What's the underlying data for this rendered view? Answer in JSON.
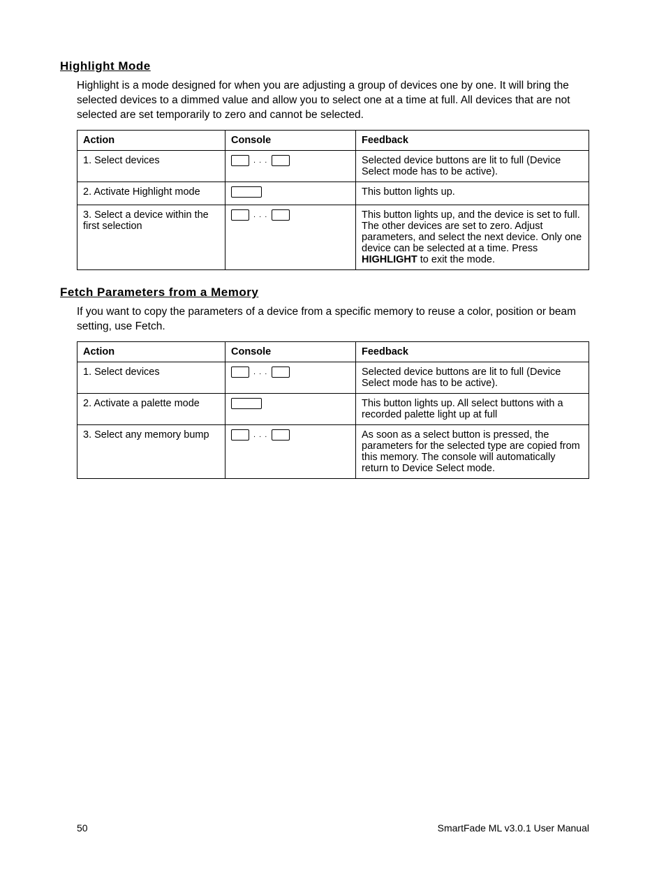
{
  "section1": {
    "heading": "Highlight Mode",
    "paragraph": "Highlight is a mode designed for when you are adjusting a group of devices one by one. It will bring the selected devices to a dimmed value and allow you to select one at a time at full. All devices that are not selected are set temporarily to zero and cannot be selected.",
    "headers": {
      "action": "Action",
      "console": "Console",
      "feedback": "Feedback"
    },
    "rows": [
      {
        "action": "1. Select devices",
        "console_type": "multi",
        "feedback": "Selected device buttons are lit to full (Device Select mode has to be active)."
      },
      {
        "action": "2. Activate Highlight mode",
        "console_type": "single",
        "feedback": "This button lights up."
      },
      {
        "action": "3. Select a device within the first selection",
        "console_type": "multi",
        "feedback_pre": "This button lights up, and the device is set to full. The other devices are set to zero. Adjust parameters, and select the next device. Only one device can be selected at a time. Press ",
        "feedback_bold": "HIGHLIGHT",
        "feedback_post": " to exit the mode."
      }
    ]
  },
  "section2": {
    "heading": "Fetch Parameters from a Memory",
    "paragraph": "If you want to copy the parameters of a device from a specific memory to reuse a color, position or beam setting, use Fetch.",
    "headers": {
      "action": "Action",
      "console": "Console",
      "feedback": "Feedback"
    },
    "rows": [
      {
        "action": "1. Select devices",
        "console_type": "multi",
        "feedback": "Selected device buttons are lit to full (Device Select mode has to be active)."
      },
      {
        "action": "2. Activate a palette mode",
        "console_type": "single",
        "feedback": "This button lights up. All select buttons with a recorded palette light up at full"
      },
      {
        "action": "3. Select any memory bump",
        "console_type": "multi",
        "feedback": "As soon as a select button is pressed, the parameters for the selected type are copied from this memory. The console will automatically return to Device Select mode."
      }
    ]
  },
  "footer": {
    "page": "50",
    "manual": "SmartFade ML v3.0.1 User Manual"
  }
}
